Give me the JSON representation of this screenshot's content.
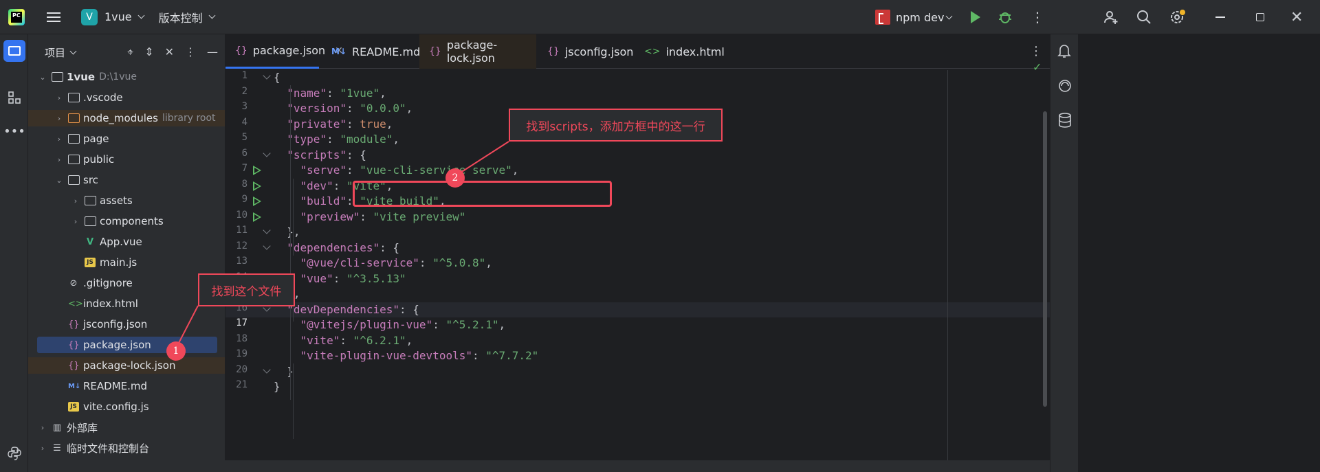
{
  "titlebar": {
    "project_badge": "V",
    "project_name": "1vue",
    "vcs_label": "版本控制",
    "run_config": "npm dev"
  },
  "project_panel": {
    "title": "项目",
    "tree": [
      {
        "label": "1vue",
        "extra": "D:\\1vue"
      },
      {
        "label": ".vscode"
      },
      {
        "label": "node_modules",
        "extra": "library root"
      },
      {
        "label": "page"
      },
      {
        "label": "public"
      },
      {
        "label": "src"
      },
      {
        "label": "assets"
      },
      {
        "label": "components"
      },
      {
        "label": "App.vue"
      },
      {
        "label": "main.js"
      },
      {
        "label": ".gitignore"
      },
      {
        "label": "index.html"
      },
      {
        "label": "jsconfig.json"
      },
      {
        "label": "package.json"
      },
      {
        "label": "package-lock.json"
      },
      {
        "label": "README.md"
      },
      {
        "label": "vite.config.js"
      },
      {
        "label": "外部库"
      },
      {
        "label": "临时文件和控制台"
      }
    ]
  },
  "tabs": [
    {
      "label": "package.json",
      "icon": "{}"
    },
    {
      "label": "README.md",
      "icon": "M↓"
    },
    {
      "label": "package-lock.json",
      "icon": "{}"
    },
    {
      "label": "jsconfig.json",
      "icon": "{}"
    },
    {
      "label": "index.html",
      "icon": "<>"
    }
  ],
  "code": {
    "line_numbers": [
      "1",
      "2",
      "3",
      "4",
      "5",
      "6",
      "7",
      "8",
      "9",
      "10",
      "11",
      "12",
      "13",
      "14",
      "15",
      "16",
      "17",
      "18",
      "19",
      "20",
      "21"
    ],
    "current_line": "17",
    "lines": [
      "{",
      "  \"name\": \"1vue\",",
      "  \"version\": \"0.0.0\",",
      "  \"private\": true,",
      "  \"type\": \"module\",",
      "  \"scripts\": {",
      "    \"serve\": \"vue-cli-service serve\",",
      "    \"dev\": \"vite\",",
      "    \"build\": \"vite build\",",
      "    \"preview\": \"vite preview\"",
      "  },",
      "  \"dependencies\": {",
      "    \"@vue/cli-service\": \"^5.0.8\",",
      "    \"vue\": \"^3.5.13\"",
      "  },",
      "  \"devDependencies\": {",
      "    \"@vitejs/plugin-vue\": \"^5.2.1\",",
      "    \"vite\": \"^6.2.1\",",
      "    \"vite-plugin-vue-devtools\": \"^7.7.2\"",
      "  }",
      "}"
    ]
  },
  "annotations": {
    "callout1": "找到这个文件",
    "callout2": "找到scripts，添加方框中的这一行",
    "badge1": "1",
    "badge2": "2"
  },
  "colors": {
    "accent": "#3574f0",
    "annotation": "#f0485a",
    "string": "#6aab73",
    "key": "#c77dbb"
  }
}
